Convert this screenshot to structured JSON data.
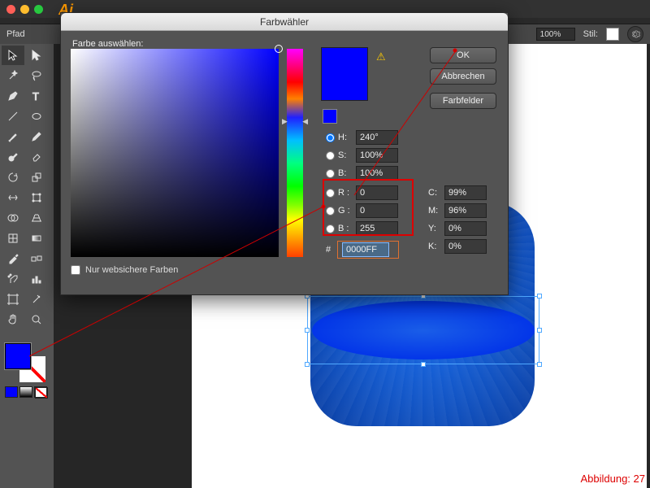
{
  "app": {
    "logo": "Ai"
  },
  "controlbar": {
    "path_label": "Pfad",
    "zoom": "100%",
    "style_label": "Stil:"
  },
  "dialog": {
    "title": "Farbwähler",
    "prompt": "Farbe auswählen:",
    "ok": "OK",
    "cancel": "Abbrechen",
    "swatches": "Farbfelder",
    "websafe": "Nur websichere Farben",
    "hsb": {
      "h_label": "H:",
      "h_val": "240°",
      "s_label": "S:",
      "s_val": "100%",
      "b_label": "B:",
      "b_val": "100%"
    },
    "rgb": {
      "r_label": "R :",
      "r_val": "0",
      "g_label": "G :",
      "g_val": "0",
      "b_label": "B :",
      "b_val": "255"
    },
    "cmyk": {
      "c_label": "C:",
      "c_val": "99%",
      "m_label": "M:",
      "m_val": "96%",
      "y_label": "Y:",
      "y_val": "0%",
      "k_label": "K:",
      "k_val": "0%"
    },
    "hex": {
      "label": "#",
      "val": "0000FF"
    },
    "selected_color": "#0000FF"
  },
  "canvas": {
    "caption": "Abbildung: 27"
  }
}
